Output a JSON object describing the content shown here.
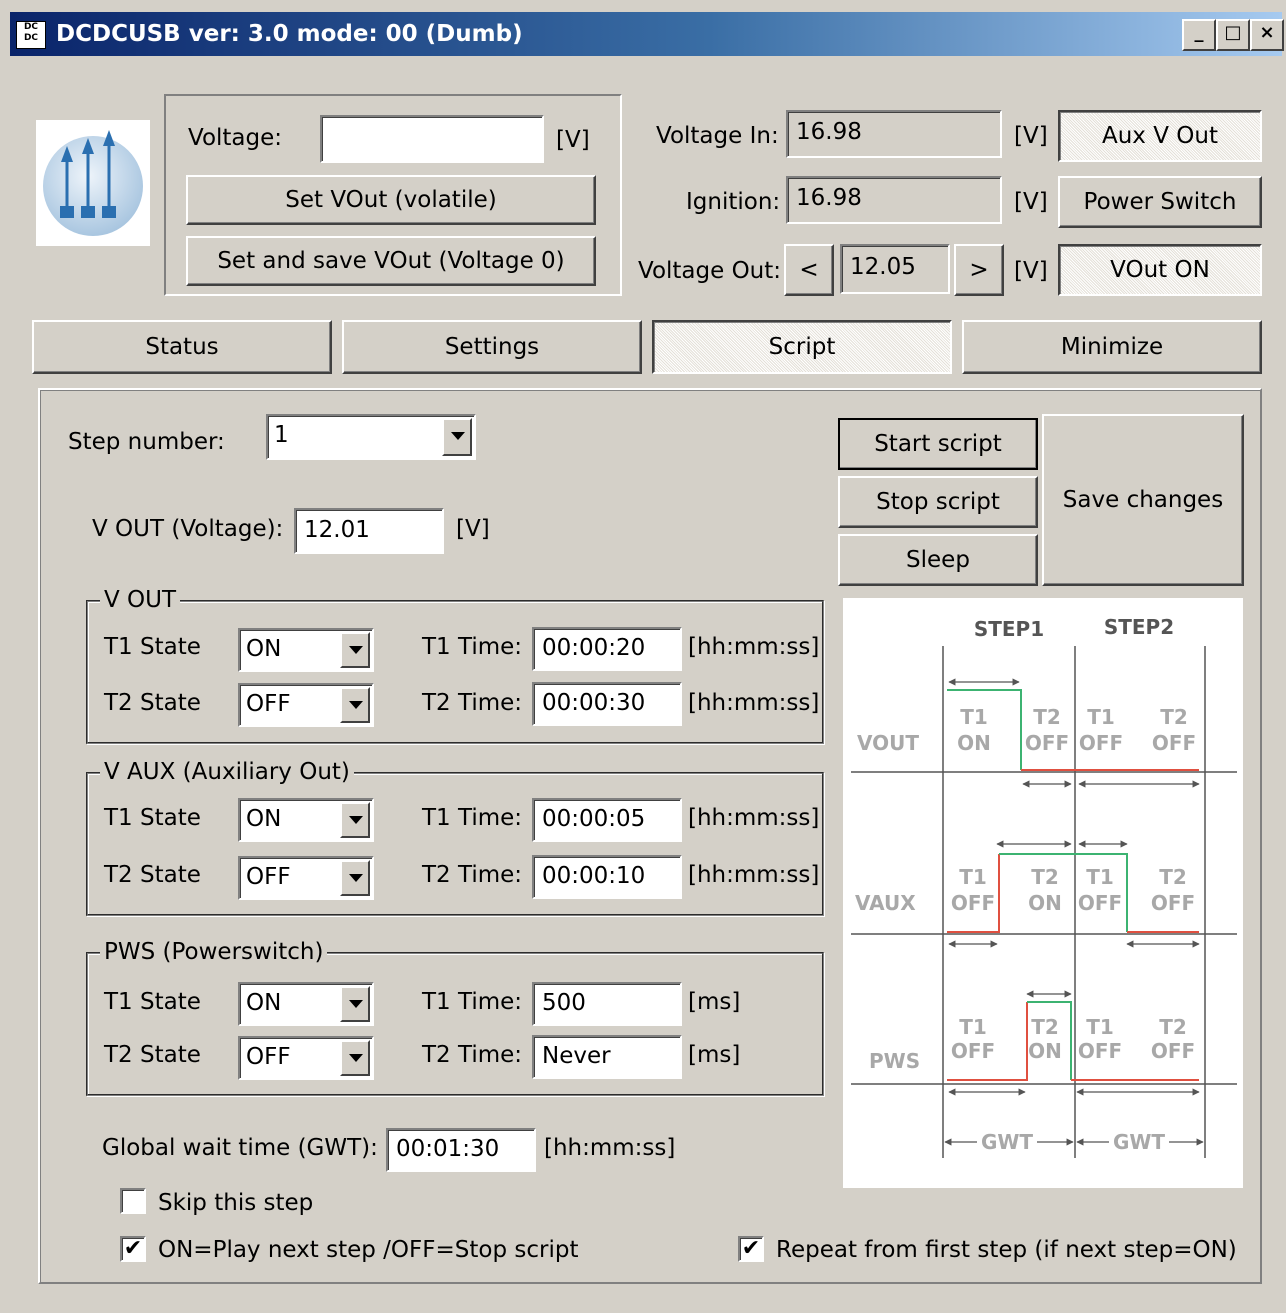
{
  "window": {
    "title": "DCDCUSB ver: 3.0 mode: 00 (Dumb)",
    "icon_text": "DC DC",
    "minimize_label": "_",
    "maximize_label": "□",
    "close_label": "×"
  },
  "top": {
    "voltage_label": "Voltage:",
    "voltage_value": "",
    "voltage_unit": "[V]",
    "set_vout_label": "Set VOut (volatile)",
    "set_save_label": "Set and save VOut (Voltage 0)",
    "voltage_in_label": "Voltage In:",
    "voltage_in_value": "16.98",
    "voltage_in_unit": "[V]",
    "ignition_label": "Ignition:",
    "ignition_value": "16.98",
    "ignition_unit": "[V]",
    "voltage_out_label": "Voltage Out:",
    "voltage_out_value": "12.05",
    "voltage_out_unit": "[V]",
    "dec_label": "<",
    "inc_label": ">",
    "aux_label": "Aux V Out",
    "power_switch_label": "Power Switch",
    "vout_on_label": "VOut ON"
  },
  "tabs": [
    {
      "label": "Status"
    },
    {
      "label": "Settings"
    },
    {
      "label": "Script"
    },
    {
      "label": "Minimize"
    }
  ],
  "script": {
    "step_number_label": "Step number:",
    "step_number_value": "1",
    "vout_voltage_label": "V OUT (Voltage):",
    "vout_voltage_value": "12.01",
    "vout_voltage_unit": "[V]",
    "groups": [
      {
        "title": "V OUT",
        "t1_state_label": "T1 State",
        "t1_state": "ON",
        "t2_state_label": "T2 State",
        "t2_state": "OFF",
        "t1_time_label": "T1 Time:",
        "t1_time": "00:00:20",
        "t2_time_label": "T2 Time:",
        "t2_time": "00:00:30",
        "unit1": "[hh:mm:ss]",
        "unit2": "[hh:mm:ss]"
      },
      {
        "title": "V AUX (Auxiliary Out)",
        "t1_state_label": "T1 State",
        "t1_state": "ON",
        "t2_state_label": "T2 State",
        "t2_state": "OFF",
        "t1_time_label": "T1 Time:",
        "t1_time": "00:00:05",
        "t2_time_label": "T2 Time:",
        "t2_time": "00:00:10",
        "unit1": "[hh:mm:ss]",
        "unit2": "[hh:mm:ss]"
      },
      {
        "title": "PWS (Powerswitch)",
        "t1_state_label": "T1 State",
        "t1_state": "ON",
        "t2_state_label": "T2 State",
        "t2_state": "OFF",
        "t1_time_label": "T1 Time:",
        "t1_time": "500",
        "t2_time_label": "T2 Time:",
        "t2_time": "Never",
        "unit1": "[ms]",
        "unit2": "[ms]"
      }
    ],
    "gwt_label": "Global wait time (GWT):",
    "gwt_value": "00:01:30",
    "gwt_unit": "[hh:mm:ss]",
    "skip_label": "Skip this step",
    "skip_checked": false,
    "play_next_label": "ON=Play next step /OFF=Stop script",
    "play_next_checked": true,
    "repeat_label": "Repeat from first step (if next step=ON)",
    "repeat_checked": true,
    "start_label": "Start script",
    "stop_label": "Stop script",
    "sleep_label": "Sleep",
    "save_label": "Save changes",
    "check_mark": "✔"
  },
  "diagram": {
    "step1": "STEP1",
    "step2": "STEP2",
    "rows": [
      {
        "name": "VOUT",
        "cols": [
          [
            "T1",
            "ON"
          ],
          [
            "T2",
            "OFF"
          ],
          [
            "T1",
            "OFF"
          ],
          [
            "T2",
            "OFF"
          ]
        ]
      },
      {
        "name": "VAUX",
        "cols": [
          [
            "T1",
            "OFF"
          ],
          [
            "T2",
            "ON"
          ],
          [
            "T1",
            "OFF"
          ],
          [
            "T2",
            "OFF"
          ]
        ]
      },
      {
        "name": "PWS",
        "cols": [
          [
            "T1",
            "OFF"
          ],
          [
            "T2",
            "ON"
          ],
          [
            "T1",
            "OFF"
          ],
          [
            "T2",
            "OFF"
          ]
        ]
      }
    ],
    "gwt": "GWT",
    "colors": {
      "on": "#3cb371",
      "off": "#e05040",
      "text": "#a8a8a8",
      "step": "#555555",
      "line": "#555555"
    }
  }
}
